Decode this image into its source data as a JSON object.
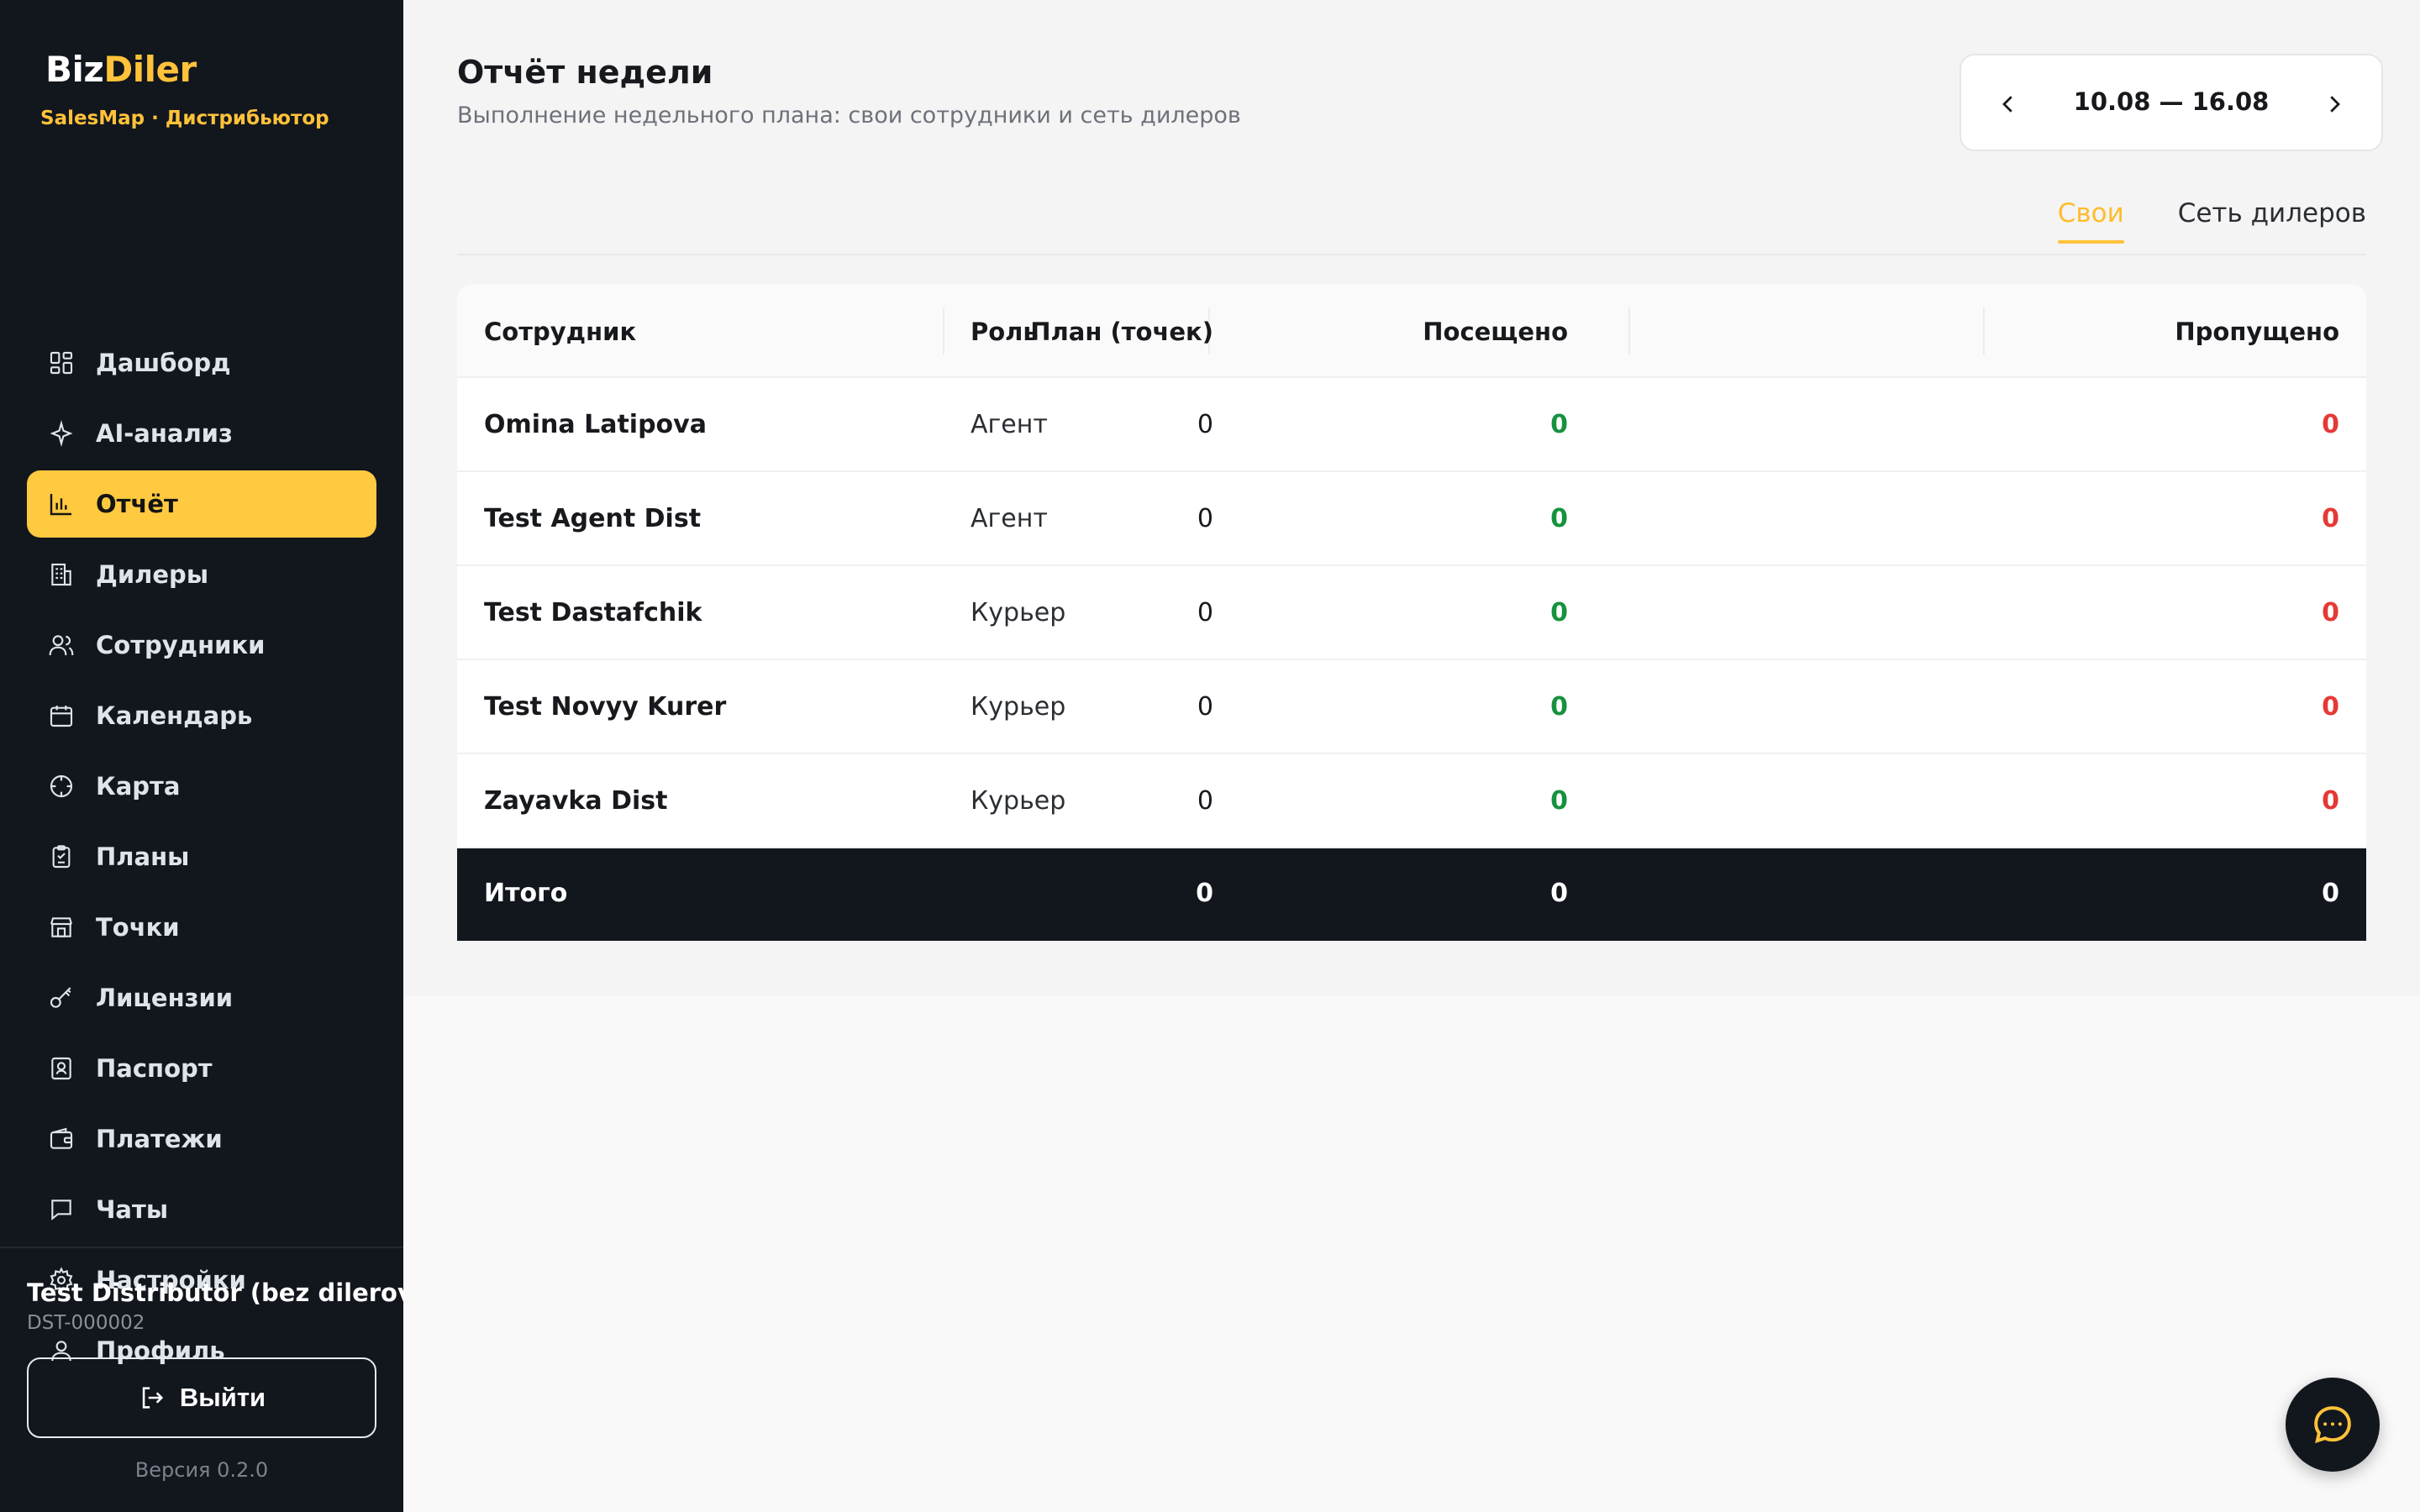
{
  "brand": {
    "name_part1": "Biz",
    "name_part2": "Diler",
    "subtitle": "SalesMap · Дистрибьютор"
  },
  "sidebar": {
    "items": [
      {
        "label": "Дашборд",
        "icon": "dashboard-icon"
      },
      {
        "label": "AI-анализ",
        "icon": "sparkle-icon"
      },
      {
        "label": "Отчёт",
        "icon": "bar-chart-icon",
        "active": true
      },
      {
        "label": "Дилеры",
        "icon": "building-icon"
      },
      {
        "label": "Сотрудники",
        "icon": "users-icon"
      },
      {
        "label": "Календарь",
        "icon": "calendar-icon"
      },
      {
        "label": "Карта",
        "icon": "crosshair-icon"
      },
      {
        "label": "Планы",
        "icon": "clipboard-icon"
      },
      {
        "label": "Точки",
        "icon": "store-icon"
      },
      {
        "label": "Лицензии",
        "icon": "key-icon"
      },
      {
        "label": "Паспорт",
        "icon": "id-card-icon"
      },
      {
        "label": "Платежи",
        "icon": "wallet-icon"
      },
      {
        "label": "Чаты",
        "icon": "chat-icon"
      },
      {
        "label": "Настройки",
        "icon": "gear-icon"
      },
      {
        "label": "Профиль",
        "icon": "user-icon"
      }
    ],
    "account_name": "Test Distributor (bez dilerov)",
    "account_id": "DST-000002",
    "logout_label": "Выйти",
    "version": "Версия 0.2.0"
  },
  "header": {
    "title": "Отчёт недели",
    "subtitle": "Выполнение недельного плана: свои сотрудники и сеть дилеров",
    "week_range": "10.08 — 16.08"
  },
  "tabs": [
    {
      "label": "Свои",
      "active": true
    },
    {
      "label": "Сеть дилеров",
      "active": false
    }
  ],
  "table": {
    "columns": [
      "Сотрудник",
      "Роль",
      "План (точек)",
      "Посещено",
      "Пропущено"
    ],
    "rows": [
      {
        "name": "Omina Latipova",
        "role": "Агент",
        "plan": "0",
        "visited": "0",
        "missed": "0"
      },
      {
        "name": "Test Agent Dist",
        "role": "Агент",
        "plan": "0",
        "visited": "0",
        "missed": "0"
      },
      {
        "name": "Test Dastafchik",
        "role": "Курьер",
        "plan": "0",
        "visited": "0",
        "missed": "0"
      },
      {
        "name": "Test Novyy Kurer",
        "role": "Курьер",
        "plan": "0",
        "visited": "0",
        "missed": "0"
      },
      {
        "name": "Zayavka Dist",
        "role": "Курьер",
        "plan": "0",
        "visited": "0",
        "missed": "0"
      }
    ],
    "total": {
      "label": "Итого",
      "plan": "0",
      "visited": "0",
      "missed": "0"
    }
  },
  "colors": {
    "accent": "#ffc23a",
    "sidebar_bg": "#12161d",
    "visited": "#16923e",
    "missed": "#e53935"
  }
}
